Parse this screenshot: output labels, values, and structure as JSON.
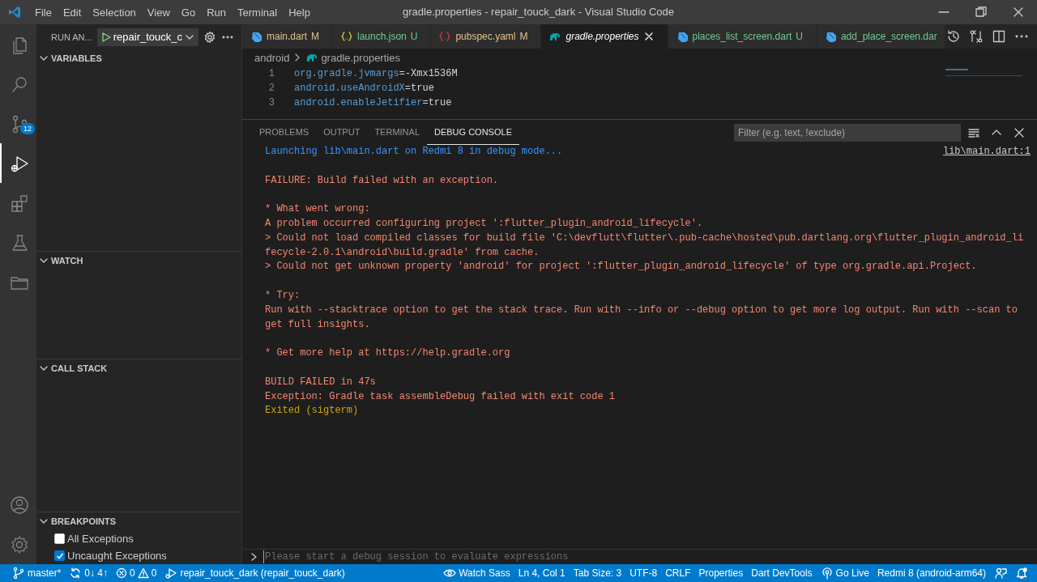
{
  "window": {
    "title": "gradle.properties - repair_touck_dark - Visual Studio Code"
  },
  "menu": [
    "File",
    "Edit",
    "Selection",
    "View",
    "Go",
    "Run",
    "Terminal",
    "Help"
  ],
  "activity_bar": {
    "items": [
      {
        "kind": "explorer",
        "selected": false
      },
      {
        "kind": "search",
        "selected": false
      },
      {
        "kind": "source_control",
        "selected": false,
        "badge": "12"
      },
      {
        "kind": "run",
        "selected": true
      },
      {
        "kind": "extensions",
        "selected": false
      },
      {
        "kind": "testing",
        "selected": false
      },
      {
        "kind": "folder",
        "selected": false
      }
    ],
    "bottom": [
      {
        "kind": "account"
      },
      {
        "kind": "settings"
      }
    ]
  },
  "sidebar": {
    "title": "RUN AN...",
    "config": "repair_touck_c",
    "sections": [
      {
        "title": "VARIABLES",
        "expanded": true
      },
      {
        "title": "WATCH",
        "expanded": true
      },
      {
        "title": "CALL STACK",
        "expanded": true
      },
      {
        "title": "BREAKPOINTS",
        "expanded": true,
        "items": [
          {
            "label": "All Exceptions",
            "checked": false
          },
          {
            "label": "Uncaught Exceptions",
            "checked": true
          }
        ]
      }
    ]
  },
  "tabs": [
    {
      "label": "main.dart",
      "kind": "dart",
      "status": "M",
      "color": "#e2c08d",
      "preview": false,
      "selected": false
    },
    {
      "label": "launch.json",
      "kind": "json",
      "status": "U",
      "color": "#73c991",
      "preview": false,
      "selected": false
    },
    {
      "label": "pubspec.yaml",
      "kind": "yaml",
      "status": "M",
      "color": "#e2c08d",
      "preview": false,
      "selected": false
    },
    {
      "label": "gradle.properties",
      "kind": "gradle",
      "color": "#ffffff",
      "preview": true,
      "selected": true
    },
    {
      "label": "places_list_screen.dart",
      "kind": "dart",
      "status": "U",
      "color": "#73c991",
      "preview": false,
      "selected": false
    },
    {
      "label": "add_place_screen.dar",
      "kind": "dart",
      "color": "#73c991",
      "preview": false,
      "selected": false
    }
  ],
  "breadcrumb": [
    "android",
    "gradle.properties"
  ],
  "code": [
    {
      "number": "1",
      "key": "org.gradle.jvmargs",
      "value": "=-Xmx1536M"
    },
    {
      "number": "2",
      "key": "android.useAndroidX",
      "value": "=true"
    },
    {
      "number": "3",
      "key": "android.enableJetifier",
      "value": "=true"
    }
  ],
  "panel": {
    "tabs": [
      {
        "label": "PROBLEMS",
        "selected": false
      },
      {
        "label": "OUTPUT",
        "selected": false
      },
      {
        "label": "TERMINAL",
        "selected": false
      },
      {
        "label": "DEBUG CONSOLE",
        "selected": true
      }
    ],
    "filter": {
      "placeholder": "Filter (e.g. text, !exclude)"
    },
    "console": [
      {
        "text": "Launching lib\\main.dart on Redmi 8 in debug mode...",
        "kind": "info",
        "space_before": false,
        "link": "lib\\main.dart:1"
      },
      {
        "text": "FAILURE: Build failed with an exception.",
        "kind": "error",
        "space_before": true
      },
      {
        "text": "* What went wrong:",
        "kind": "error",
        "space_before": true
      },
      {
        "text": "A problem occurred configuring project ':flutter_plugin_android_lifecycle'.",
        "kind": "error",
        "space_before": false
      },
      {
        "text": "> Could not load compiled classes for build file 'C:\\devflutt\\flutter\\.pub-cache\\hosted\\pub.dartlang.org\\flutter_plugin_android_lifecycle-2.0.1\\android\\build.gradle' from cache.",
        "kind": "error",
        "space_before": false
      },
      {
        "text": "> Could not get unknown property 'android' for project ':flutter_plugin_android_lifecycle' of type org.gradle.api.Project.",
        "kind": "error",
        "space_before": false
      },
      {
        "text": "* Try:",
        "kind": "error",
        "space_before": true
      },
      {
        "text": "Run with --stacktrace option to get the stack trace. Run with --info or --debug option to get more log output. Run with --scan to get full insights.",
        "kind": "error",
        "space_before": false
      },
      {
        "text": "* Get more help at https://help.gradle.org",
        "kind": "error",
        "space_before": true
      },
      {
        "text": "BUILD FAILED in 47s",
        "kind": "error",
        "space_before": true
      },
      {
        "text": "Exception: Gradle task assembleDebug failed with exit code 1",
        "kind": "error",
        "space_before": false
      },
      {
        "text": "Exited (sigterm)",
        "kind": "warning",
        "space_before": false
      }
    ],
    "input": {
      "placeholder": "Please start a debug session to evaluate expressions"
    }
  },
  "status_bar": {
    "left": [
      {
        "kind": "branch",
        "text": "master*"
      },
      {
        "kind": "sync",
        "text": "0↓ 4↑"
      },
      {
        "kind": "problems",
        "errors": "0",
        "warnings": "0"
      },
      {
        "kind": "debug",
        "text": "repair_touck_dark (repair_touck_dark)"
      }
    ],
    "right": [
      {
        "kind": "watch",
        "text": "Watch Sass"
      },
      {
        "kind": "plain",
        "text": "Ln 4, Col 1"
      },
      {
        "kind": "plain",
        "text": "Tab Size: 3"
      },
      {
        "kind": "plain",
        "text": "UTF-8"
      },
      {
        "kind": "plain",
        "text": "CRLF"
      },
      {
        "kind": "plain",
        "text": "Properties"
      },
      {
        "kind": "plain",
        "text": "Dart DevTools"
      },
      {
        "kind": "live",
        "text": "Go Live"
      },
      {
        "kind": "plain",
        "text": "Redmi 8 (android-arm64)"
      },
      {
        "kind": "feedback"
      },
      {
        "kind": "bell"
      }
    ]
  }
}
